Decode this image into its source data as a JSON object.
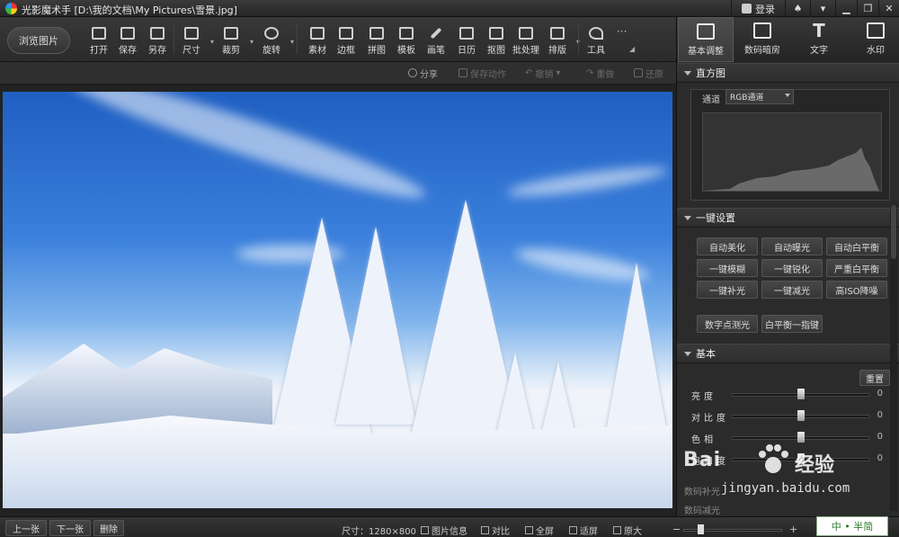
{
  "titlebar": {
    "title": "光影魔术手  [D:\\我的文档\\My Pictures\\雪景.jpg]",
    "login": "登录"
  },
  "toolbar": {
    "browse": "浏览图片",
    "tools": [
      "打开",
      "保存",
      "另存",
      "尺寸",
      "裁剪",
      "旋转",
      "素材",
      "边框",
      "拼图",
      "模板",
      "画笔",
      "日历",
      "抠图",
      "批处理",
      "排版",
      "工具"
    ]
  },
  "right_tabs": [
    "基本调整",
    "数码暗房",
    "文字",
    "水印"
  ],
  "subbar": {
    "share": "分享",
    "save_action": "保存动作",
    "undo": "撤销",
    "redo": "重做",
    "restore": "还原"
  },
  "panel": {
    "histogram_title": "直方图",
    "channel_label": "通道",
    "channel_value": "RGB通道",
    "oneclick_title": "一键设置",
    "oneclick_buttons": [
      "自动美化",
      "自动曝光",
      "自动白平衡",
      "一键模糊",
      "一键锐化",
      "严重白平衡",
      "一键补光",
      "一键减光",
      "高ISO降噪"
    ],
    "extra_buttons": [
      "数字点测光",
      "白平衡一指键"
    ],
    "basic_title": "基本",
    "reset": "重置",
    "sliders": [
      {
        "label": "亮度",
        "value": "0",
        "level": 0.5
      },
      {
        "label": "对比度",
        "value": "0",
        "level": 0.5
      },
      {
        "label": "色相",
        "value": "0",
        "level": 0.5
      },
      {
        "label": "饱和度",
        "value": "0",
        "level": 0.5
      }
    ],
    "collapsed": [
      "数码补光",
      "数码减光"
    ]
  },
  "statusbar": {
    "prev": "上一张",
    "next": "下一张",
    "delete": "删除",
    "size": "尺寸：1280×800",
    "info": "图片信息",
    "compare": "对比",
    "fullscreen": "全屏",
    "fit": "适屏",
    "original": "原大",
    "zoom_minus": "−",
    "zoom_plus": "+"
  },
  "watermark": {
    "brand1": "Bai",
    "brand2": "经验",
    "url": "jingyan.baidu.com"
  },
  "ime": "中 • 半简"
}
